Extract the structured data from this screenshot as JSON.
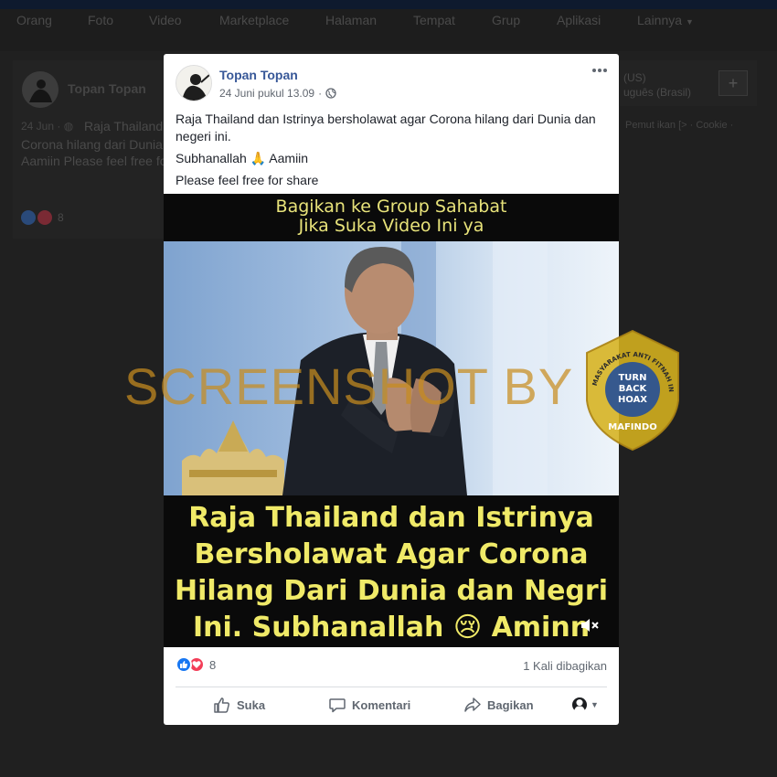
{
  "background": {
    "nav": [
      "Orang",
      "Foto",
      "Video",
      "Marketplace",
      "Halaman",
      "Tempat",
      "Grup",
      "Aplikasi",
      "Lainnya"
    ],
    "card": {
      "name": "Topan Topan",
      "meta": "24 Jun ·",
      "lines": [
        "Raja Thailand",
        "Corona hilang dari Dunia",
        "Aamiin Please feel free fo"
      ],
      "reaction_count": "8"
    },
    "right": {
      "lang_1": "(US)",
      "lang_2": "uguês (Brasil)",
      "plus": "+",
      "links": "Pemut ikan [> · Cookie ·"
    }
  },
  "watermark": {
    "text": "SCREENSHOT BY",
    "seal_top": "MASYARAKAT ANTI FITNAH INDONESIA",
    "seal_center": [
      "TURN",
      "BACK",
      "HOAX"
    ],
    "seal_bottom": "MAFINDO"
  },
  "post": {
    "author": "Topan Topan",
    "date": "24 Juni pukul 13.09",
    "caption_lines": [
      "Raja Thailand dan Istrinya bersholawat agar Corona hilang dari Dunia dan negeri ini.",
      "Subhanallah 🙏 Aamiin",
      "Please feel free for share"
    ],
    "video": {
      "top_caption": [
        "Bagikan ke Group Sahabat",
        "Jika Suka Video Ini ya"
      ],
      "bottom_caption": [
        "Raja Thailand dan Istrinya",
        "Bersholawat Agar Corona",
        "Hilang Dari Dunia dan Negri",
        "Ini. Subhanallah 😢 Aminn"
      ]
    },
    "reactions": {
      "count": "8",
      "types": [
        "like-icon",
        "love-icon"
      ]
    },
    "shares": "1 Kali dibagikan",
    "actions": {
      "like": "Suka",
      "comment": "Komentari",
      "share": "Bagikan"
    }
  },
  "colors": {
    "link_blue": "#385898",
    "like_blue": "#1877f2",
    "love_red": "#f33e58",
    "caption_yellow": "#f0ea68",
    "watermark_orange": "#c88c1e"
  }
}
